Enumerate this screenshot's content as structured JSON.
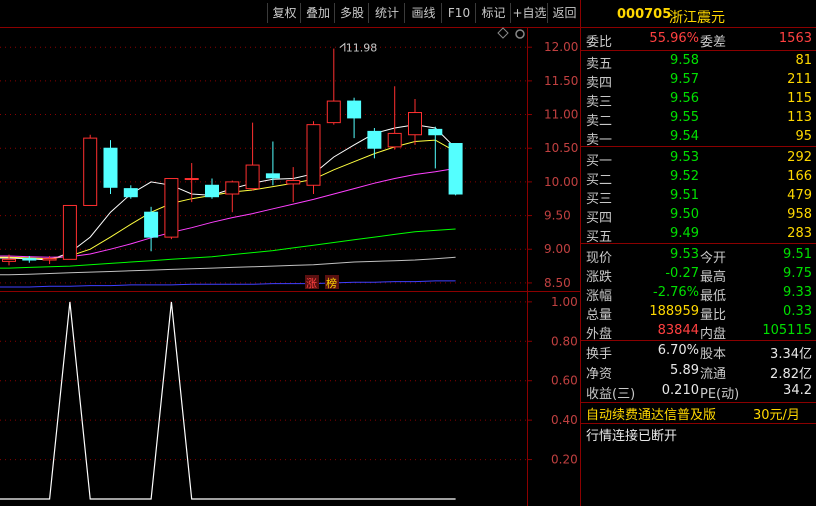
{
  "toolbar": [
    "复权",
    "叠加",
    "多股",
    "统计",
    "画线",
    "F10",
    "标记",
    "+自选",
    "返回"
  ],
  "stock": {
    "code": "000705",
    "name": "浙江震元"
  },
  "weibi": {
    "label": "委比",
    "value": "55.96%",
    "label2": "委差",
    "value2": "1563"
  },
  "sells": [
    {
      "label": "卖五",
      "price": "9.58",
      "vol": "81"
    },
    {
      "label": "卖四",
      "price": "9.57",
      "vol": "211"
    },
    {
      "label": "卖三",
      "price": "9.56",
      "vol": "115"
    },
    {
      "label": "卖二",
      "price": "9.55",
      "vol": "113"
    },
    {
      "label": "卖一",
      "price": "9.54",
      "vol": "95"
    }
  ],
  "buys": [
    {
      "label": "买一",
      "price": "9.53",
      "vol": "292"
    },
    {
      "label": "买二",
      "price": "9.52",
      "vol": "166"
    },
    {
      "label": "买三",
      "price": "9.51",
      "vol": "479"
    },
    {
      "label": "买四",
      "price": "9.50",
      "vol": "958"
    },
    {
      "label": "买五",
      "price": "9.49",
      "vol": "283"
    }
  ],
  "stats": [
    {
      "l1": "现价",
      "v1": "9.53",
      "l2": "今开",
      "v2": "9.51",
      "c1": "green",
      "c2": "green"
    },
    {
      "l1": "涨跌",
      "v1": "-0.27",
      "l2": "最高",
      "v2": "9.75",
      "c1": "green",
      "c2": "green"
    },
    {
      "l1": "涨幅",
      "v1": "-2.76%",
      "l2": "最低",
      "v2": "9.33",
      "c1": "green",
      "c2": "green"
    },
    {
      "l1": "总量",
      "v1": "188959",
      "l2": "量比",
      "v2": "0.33",
      "c1": "yellow",
      "c2": "green"
    },
    {
      "l1": "外盘",
      "v1": "83844",
      "l2": "内盘",
      "v2": "105115",
      "c1": "red",
      "c2": "green"
    }
  ],
  "stats2": [
    {
      "l1": "换手",
      "v1": "6.70%",
      "l2": "股本",
      "v2": "3.34亿"
    },
    {
      "l1": "净资",
      "v1": "5.89",
      "l2": "流通",
      "v2": "2.82亿"
    },
    {
      "l1": "收益(三)",
      "v1": "0.210",
      "l2": "PE(动)",
      "v2": "34.2"
    }
  ],
  "promo": {
    "text": "自动续费通达信普及版",
    "price": "30元/月"
  },
  "status_text": "行情连接已断开",
  "chart_markers": {
    "high_label": "11.98",
    "tag1": "涨",
    "tag2": "榜"
  },
  "colors": {
    "up": "#ff3030",
    "down": "#54ffff",
    "ma5": "#ffffff",
    "ma10": "#ffff40",
    "ma20": "#ff40ff",
    "ma30": "#00ff00",
    "ma60": "#c0c0c0",
    "ma120": "#4040ff",
    "grid": "#8b0000"
  },
  "chart_data": [
    {
      "type": "candlestick",
      "y_ticks": [
        "12.00",
        "11.50",
        "11.00",
        "10.50",
        "10.00",
        "9.50",
        "9.00",
        "8.50"
      ],
      "ylim": [
        8.38,
        12.3
      ],
      "candles": [
        {
          "o": 8.82,
          "h": 8.92,
          "l": 8.76,
          "c": 8.85
        },
        {
          "o": 8.86,
          "h": 8.9,
          "l": 8.8,
          "c": 8.84
        },
        {
          "o": 8.84,
          "h": 8.9,
          "l": 8.78,
          "c": 8.86
        },
        {
          "o": 8.85,
          "h": 9.65,
          "l": 8.85,
          "c": 9.65
        },
        {
          "o": 9.65,
          "h": 10.7,
          "l": 9.65,
          "c": 10.65
        },
        {
          "o": 10.5,
          "h": 10.62,
          "l": 9.82,
          "c": 9.92
        },
        {
          "o": 9.9,
          "h": 9.95,
          "l": 9.75,
          "c": 9.78
        },
        {
          "o": 9.55,
          "h": 9.63,
          "l": 8.97,
          "c": 9.18
        },
        {
          "o": 9.18,
          "h": 10.05,
          "l": 9.15,
          "c": 10.05
        },
        {
          "o": 10.05,
          "h": 10.28,
          "l": 9.7,
          "c": 10.05
        },
        {
          "o": 9.95,
          "h": 10.05,
          "l": 9.75,
          "c": 9.78
        },
        {
          "o": 9.82,
          "h": 10.02,
          "l": 9.55,
          "c": 10.0
        },
        {
          "o": 9.9,
          "h": 10.88,
          "l": 9.87,
          "c": 10.25
        },
        {
          "o": 10.12,
          "h": 10.6,
          "l": 9.95,
          "c": 10.06
        },
        {
          "o": 9.97,
          "h": 10.22,
          "l": 9.7,
          "c": 10.02
        },
        {
          "o": 9.95,
          "h": 10.9,
          "l": 9.82,
          "c": 10.85
        },
        {
          "o": 10.88,
          "h": 11.98,
          "l": 10.85,
          "c": 11.2
        },
        {
          "o": 11.2,
          "h": 11.25,
          "l": 10.65,
          "c": 10.95
        },
        {
          "o": 10.75,
          "h": 10.8,
          "l": 10.35,
          "c": 10.5
        },
        {
          "o": 10.52,
          "h": 11.42,
          "l": 10.48,
          "c": 10.72
        },
        {
          "o": 10.7,
          "h": 11.23,
          "l": 10.55,
          "c": 11.03
        },
        {
          "o": 10.78,
          "h": 10.82,
          "l": 10.2,
          "c": 10.7
        },
        {
          "o": 10.57,
          "h": 10.57,
          "l": 9.8,
          "c": 9.82
        }
      ],
      "ma": [
        {
          "name": "MA5",
          "values": [
            8.87,
            8.86,
            8.84,
            8.95,
            9.18,
            9.55,
            9.82,
            10.0,
            9.95,
            9.82,
            9.8,
            9.9,
            9.98,
            10.04,
            10.05,
            10.12,
            10.37,
            10.55,
            10.72,
            10.8,
            10.85,
            10.8,
            10.5
          ]
        },
        {
          "name": "MA10",
          "values": [
            8.88,
            8.87,
            8.86,
            8.9,
            9.0,
            9.18,
            9.37,
            9.55,
            9.68,
            9.75,
            9.8,
            9.85,
            9.88,
            9.93,
            9.98,
            10.04,
            10.18,
            10.3,
            10.42,
            10.52,
            10.6,
            10.62,
            10.45
          ]
        },
        {
          "name": "MA20",
          "values": [
            8.9,
            8.89,
            8.88,
            8.89,
            8.93,
            9.0,
            9.08,
            9.17,
            9.25,
            9.32,
            9.4,
            9.47,
            9.53,
            9.6,
            9.67,
            9.74,
            9.82,
            9.9,
            9.98,
            10.05,
            10.11,
            10.15,
            10.2
          ]
        },
        {
          "name": "MA30",
          "values": [
            8.72,
            8.73,
            8.74,
            8.75,
            8.77,
            8.79,
            8.81,
            8.83,
            8.85,
            8.87,
            8.89,
            8.92,
            8.95,
            8.98,
            9.02,
            9.06,
            9.1,
            9.14,
            9.18,
            9.22,
            9.26,
            9.28,
            9.3
          ]
        },
        {
          "name": "MA60",
          "values": [
            8.62,
            8.63,
            8.64,
            8.65,
            8.66,
            8.67,
            8.68,
            8.69,
            8.7,
            8.71,
            8.72,
            8.73,
            8.74,
            8.75,
            8.76,
            8.77,
            8.79,
            8.81,
            8.82,
            8.83,
            8.84,
            8.86,
            8.88
          ]
        },
        {
          "name": "MA120",
          "values": [
            8.44,
            8.44,
            8.45,
            8.45,
            8.46,
            8.46,
            8.47,
            8.47,
            8.47,
            8.48,
            8.48,
            8.48,
            8.48,
            8.49,
            8.49,
            8.49,
            8.5,
            8.51,
            8.51,
            8.52,
            8.52,
            8.53,
            8.53
          ]
        }
      ]
    },
    {
      "type": "line",
      "y_ticks": [
        "1.00",
        "0.80",
        "0.60",
        "0.40",
        "0.20"
      ],
      "ylim": [
        0,
        1.05
      ],
      "values": [
        0,
        0,
        0,
        1,
        0,
        0,
        0,
        0,
        1,
        0,
        0,
        0,
        0,
        0,
        0,
        0,
        0,
        0,
        0,
        0,
        0,
        0,
        0
      ]
    }
  ]
}
